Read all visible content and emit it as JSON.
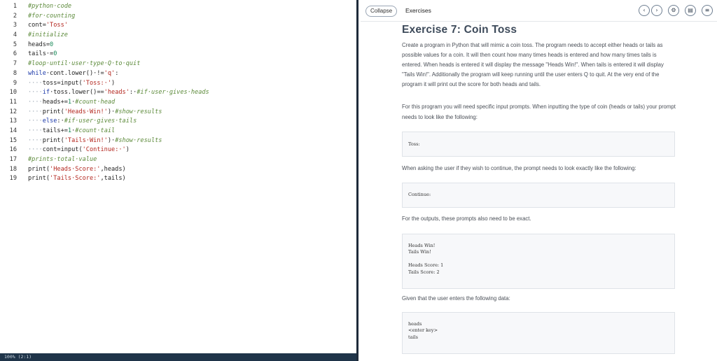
{
  "editor": {
    "lines": [
      {
        "n": "1",
        "seg": [
          [
            "c-com",
            "#python·code"
          ]
        ]
      },
      {
        "n": "2",
        "seg": [
          [
            "c-com",
            "#for·counting"
          ]
        ]
      },
      {
        "n": "3",
        "seg": [
          [
            "tx",
            "cont="
          ],
          [
            "c-str",
            "'Toss'"
          ]
        ]
      },
      {
        "n": "4",
        "seg": [
          [
            "c-com",
            "#initialize"
          ]
        ]
      },
      {
        "n": "5",
        "seg": [
          [
            "tx",
            "heads="
          ],
          [
            "c-num",
            "0"
          ]
        ]
      },
      {
        "n": "6",
        "seg": [
          [
            "tx",
            "tails·="
          ],
          [
            "c-num",
            "0"
          ]
        ]
      },
      {
        "n": "7",
        "seg": [
          [
            "c-com",
            "#loop·until·user·type·Q·to·quit"
          ]
        ]
      },
      {
        "n": "8",
        "seg": [
          [
            "c-kw",
            "while"
          ],
          [
            "tx",
            "·cont.lower()·!="
          ],
          [
            "c-str",
            "'q'"
          ],
          [
            "tx",
            ":"
          ]
        ]
      },
      {
        "n": "9",
        "seg": [
          [
            "c-dot",
            "····"
          ],
          [
            "tx",
            "toss=input("
          ],
          [
            "c-str",
            "'Toss:·'"
          ],
          [
            "tx",
            ")"
          ]
        ]
      },
      {
        "n": "10",
        "seg": [
          [
            "c-dot",
            "····"
          ],
          [
            "c-kw",
            "if"
          ],
          [
            "tx",
            "·toss.lower()=="
          ],
          [
            "c-str",
            "'heads'"
          ],
          [
            "tx",
            ":·"
          ],
          [
            "c-com",
            "#if·user·gives·heads"
          ]
        ]
      },
      {
        "n": "11",
        "seg": [
          [
            "c-dot",
            "····"
          ],
          [
            "tx",
            "heads+="
          ],
          [
            "c-num",
            "1"
          ],
          [
            "tx",
            "·"
          ],
          [
            "c-com",
            "#count·head"
          ]
        ]
      },
      {
        "n": "12",
        "seg": [
          [
            "c-dot",
            "····"
          ],
          [
            "tx",
            "print("
          ],
          [
            "c-str",
            "'Heads·Win!'"
          ],
          [
            "tx",
            ")·"
          ],
          [
            "c-com",
            "#show·results"
          ]
        ]
      },
      {
        "n": "13",
        "seg": [
          [
            "c-dot",
            "····"
          ],
          [
            "c-kw",
            "else"
          ],
          [
            "tx",
            ":·"
          ],
          [
            "c-com",
            "#if·user·gives·tails"
          ]
        ]
      },
      {
        "n": "14",
        "seg": [
          [
            "c-dot",
            "····"
          ],
          [
            "tx",
            "tails+="
          ],
          [
            "c-num",
            "1"
          ],
          [
            "tx",
            "·"
          ],
          [
            "c-com",
            "#count·tail"
          ]
        ]
      },
      {
        "n": "15",
        "seg": [
          [
            "c-dot",
            "····"
          ],
          [
            "tx",
            "print("
          ],
          [
            "c-str",
            "'Tails·Win!'"
          ],
          [
            "tx",
            ")·"
          ],
          [
            "c-com",
            "#show·results"
          ]
        ]
      },
      {
        "n": "16",
        "seg": [
          [
            "c-dot",
            "····"
          ],
          [
            "tx",
            "cont=input("
          ],
          [
            "c-str",
            "'Continue:·'"
          ],
          [
            "tx",
            ")"
          ]
        ]
      },
      {
        "n": "17",
        "seg": [
          [
            "c-com",
            "#prints·total·value"
          ]
        ]
      },
      {
        "n": "18",
        "seg": [
          [
            "tx",
            "print("
          ],
          [
            "c-str",
            "'Heads·Score:'"
          ],
          [
            "tx",
            ",heads)"
          ]
        ]
      },
      {
        "n": "19",
        "seg": [
          [
            "tx",
            "print("
          ],
          [
            "c-str",
            "'Tails·Score:'"
          ],
          [
            "tx",
            ",tails)"
          ]
        ]
      }
    ],
    "status": "100%  (2:1)"
  },
  "panel": {
    "collapse_label": "Collapse",
    "exercises_label": "Exercises",
    "icons": [
      "chevron-left-icon",
      "chevron-right-icon",
      "gear-icon",
      "book-icon",
      "menu-icon"
    ],
    "title": "Exercise 7: Coin Toss",
    "p1": "Create a program in Python that will mimic a coin toss. The program needs to accept either heads or tails as possible values for a coin. It will then count how many times heads is entered and how many times tails is entered. When heads is entered it will display the message \"Heads Win!\". When tails is entered it will display \"Tails Win!\". Additionally the program will keep running until the user enters Q to quit. At the very end of the program it will print out the score for both heads and tails.",
    "p2": "For this program you will need specific input prompts. When inputting the type of coin (heads or tails) your prompt needs to look like the following:",
    "box1": [
      "Toss:"
    ],
    "p3": "When asking the user if they wish to continue, the prompt needs to look exactly like the following:",
    "box2": [
      "Continue:"
    ],
    "p4": "For the outputs, these prompts also need to be exact.",
    "box3": [
      "Heads Win!",
      "Tails Win!",
      "",
      "Heads Score: 1",
      "Tails Score: 2"
    ],
    "p5": "Given that the user enters the following data:",
    "box4": [
      "heads",
      "<enter key>",
      "tails"
    ]
  }
}
